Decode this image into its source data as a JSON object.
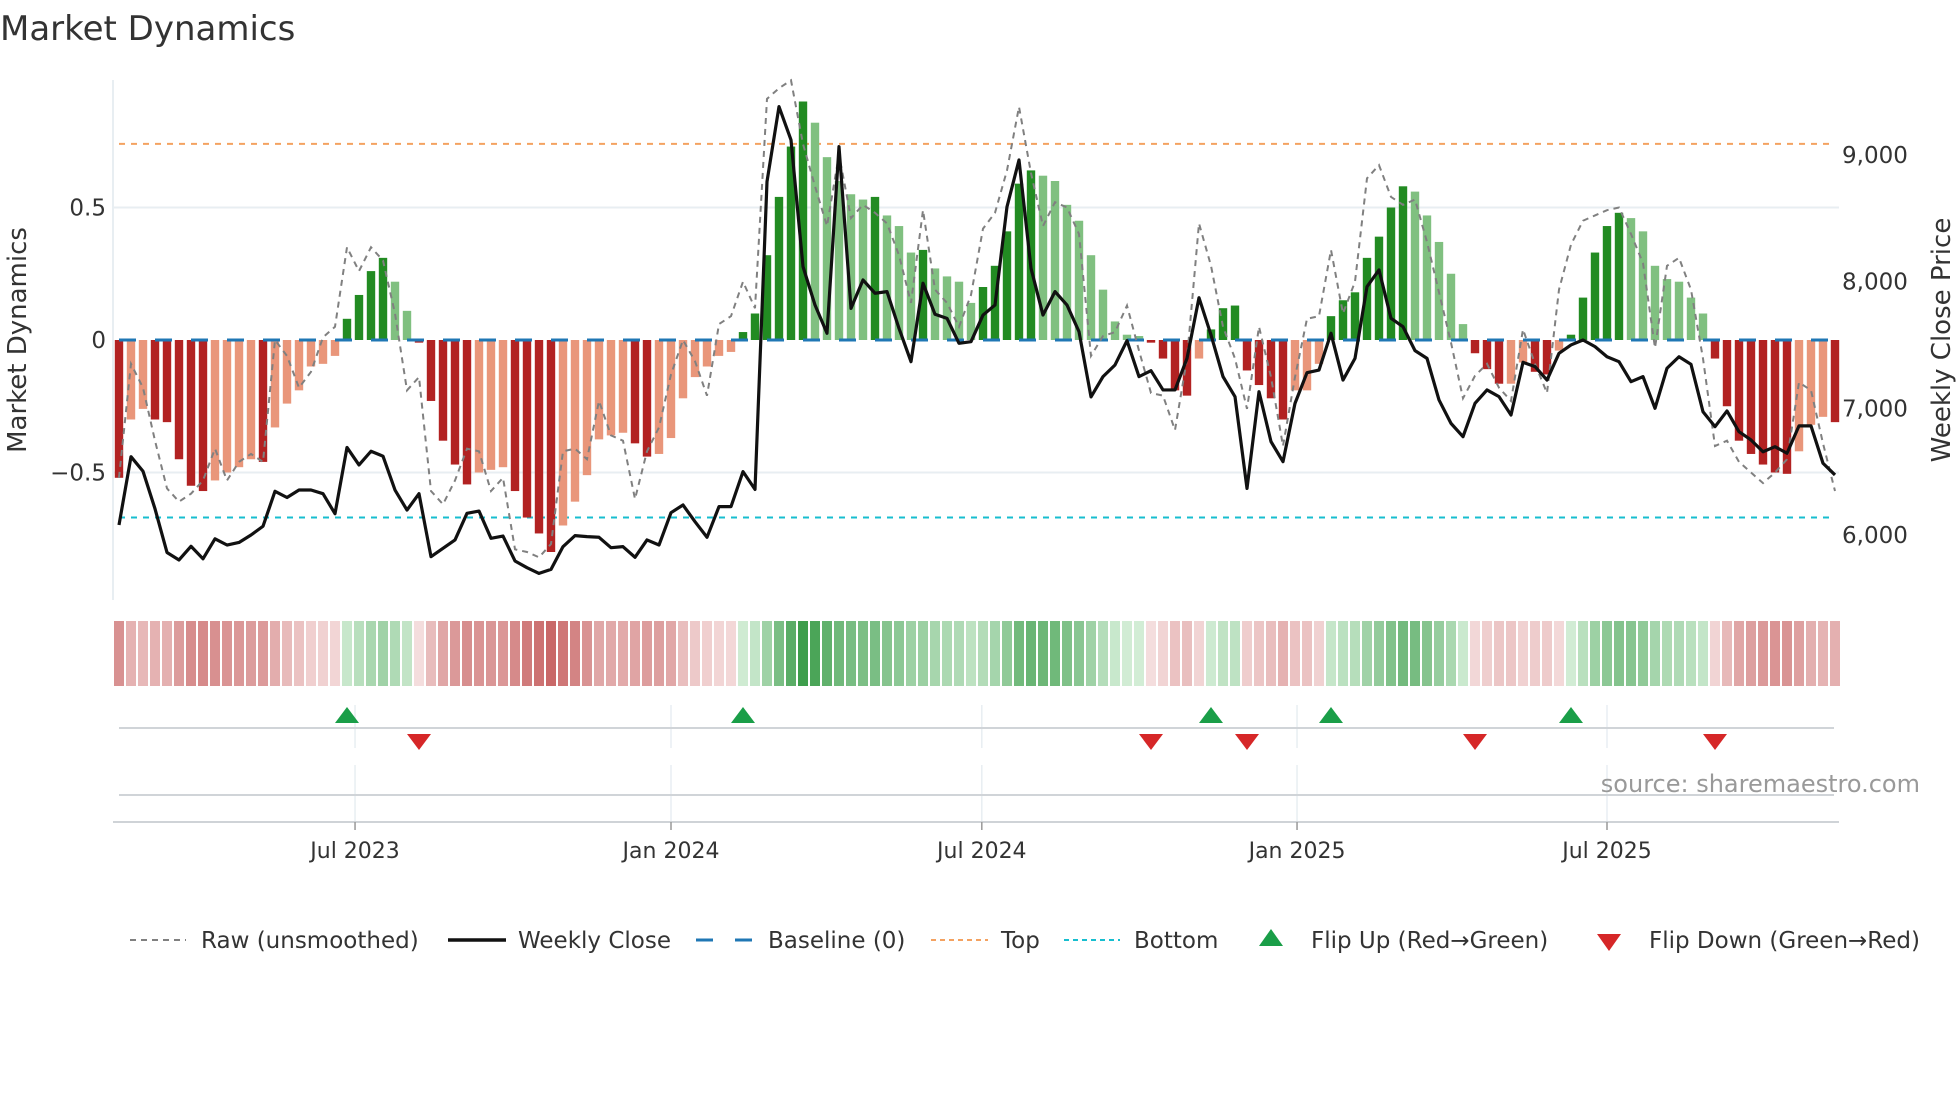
{
  "chart_data": {
    "type": "bar",
    "title": "Market Dynamics",
    "ylabel": "Market Dynamics",
    "y2label": "Weekly Close Price",
    "source": "source: sharemaestro.com",
    "frequency": "weekly",
    "ylim": [
      -0.9,
      1.0
    ],
    "y2lim": [
      5600,
      9700
    ],
    "left_ticks": [
      {
        "value": 0.5,
        "label": "0.5"
      },
      {
        "value": 0,
        "label": "0"
      },
      {
        "value": -0.5,
        "label": "−0.5"
      }
    ],
    "right_ticks": [
      {
        "value": 9000,
        "label": "9,000"
      },
      {
        "value": 8000,
        "label": "8,000"
      },
      {
        "value": 7000,
        "label": "7,000"
      },
      {
        "value": 6000,
        "label": "6,000"
      }
    ],
    "x_ticks": [
      {
        "label": "Jul 2023",
        "week_index": 19.67
      },
      {
        "label": "Jan 2024",
        "week_index": 46.0
      },
      {
        "label": "Jul 2024",
        "week_index": 71.9
      },
      {
        "label": "Jan 2025",
        "week_index": 98.17
      },
      {
        "label": "Jul 2025",
        "week_index": 124.0
      }
    ],
    "top_level": 0.74,
    "bottom_level": -0.67,
    "baseline": 0,
    "colors": {
      "pos_strong": "#228b22",
      "pos_weak": "#80c080",
      "neg_strong": "#b22222",
      "neg_weak": "#e9967a",
      "raw": "#808080",
      "close": "#111111",
      "baseline": "#1f77b4",
      "top": "#f4a261",
      "bottom": "#17becf",
      "flip_up": "#1a9e48",
      "flip_down": "#d62728"
    },
    "series": [
      {
        "name": "Market Dynamics (smoothed)",
        "values": [
          -0.52,
          -0.3,
          -0.26,
          -0.3,
          -0.31,
          -0.45,
          -0.55,
          -0.57,
          -0.53,
          -0.5,
          -0.48,
          -0.45,
          -0.46,
          -0.33,
          -0.24,
          -0.19,
          -0.1,
          -0.09,
          -0.06,
          0.08,
          0.17,
          0.26,
          0.31,
          0.22,
          0.11,
          -0.01,
          -0.23,
          -0.38,
          -0.47,
          -0.545,
          -0.5,
          -0.49,
          -0.48,
          -0.57,
          -0.67,
          -0.73,
          -0.8,
          -0.7,
          -0.61,
          -0.51,
          -0.375,
          -0.36,
          -0.35,
          -0.39,
          -0.44,
          -0.43,
          -0.37,
          -0.22,
          -0.14,
          -0.1,
          -0.06,
          -0.045,
          0.03,
          0.1,
          0.32,
          0.54,
          0.73,
          0.9,
          0.82,
          0.69,
          0.6,
          0.55,
          0.53,
          0.54,
          0.47,
          0.43,
          0.33,
          0.34,
          0.27,
          0.24,
          0.22,
          0.14,
          0.2,
          0.28,
          0.41,
          0.59,
          0.64,
          0.62,
          0.6,
          0.51,
          0.45,
          0.32,
          0.19,
          0.07,
          0.02,
          0.015,
          -0.01,
          -0.07,
          -0.19,
          -0.21,
          -0.07,
          0.04,
          0.12,
          0.13,
          -0.115,
          -0.17,
          -0.22,
          -0.3,
          -0.19,
          -0.19,
          -0.09,
          0.09,
          0.15,
          0.18,
          0.31,
          0.39,
          0.5,
          0.58,
          0.56,
          0.47,
          0.37,
          0.25,
          0.06,
          -0.05,
          -0.11,
          -0.165,
          -0.165,
          -0.085,
          -0.12,
          -0.13,
          -0.04,
          0.02,
          0.16,
          0.33,
          0.43,
          0.48,
          0.46,
          0.41,
          0.28,
          0.23,
          0.22,
          0.16,
          0.1,
          -0.07,
          -0.25,
          -0.38,
          -0.43,
          -0.47,
          -0.5,
          -0.505,
          -0.42,
          -0.32,
          -0.29,
          -0.31
        ]
      },
      {
        "name": "Raw (unsmoothed)",
        "values": [
          -0.52,
          -0.09,
          -0.18,
          -0.38,
          -0.56,
          -0.61,
          -0.58,
          -0.53,
          -0.41,
          -0.53,
          -0.46,
          -0.43,
          -0.46,
          0.0,
          -0.06,
          -0.18,
          -0.12,
          0.01,
          0.05,
          0.35,
          0.26,
          0.35,
          0.3,
          0.1,
          -0.19,
          -0.14,
          -0.57,
          -0.62,
          -0.53,
          -0.41,
          -0.42,
          -0.57,
          -0.52,
          -0.79,
          -0.8,
          -0.82,
          -0.77,
          -0.42,
          -0.41,
          -0.45,
          -0.23,
          -0.36,
          -0.38,
          -0.6,
          -0.42,
          -0.33,
          -0.13,
          0.0,
          -0.08,
          -0.21,
          0.06,
          0.09,
          0.22,
          0.12,
          0.91,
          0.95,
          0.98,
          0.74,
          0.58,
          0.43,
          0.7,
          0.46,
          0.51,
          0.48,
          0.44,
          0.32,
          0.14,
          0.49,
          0.19,
          0.14,
          0.05,
          0.17,
          0.42,
          0.48,
          0.64,
          0.88,
          0.63,
          0.43,
          0.52,
          0.5,
          0.4,
          -0.06,
          0.015,
          0.03,
          0.13,
          -0.04,
          -0.2,
          -0.21,
          -0.34,
          -0.07,
          0.44,
          0.28,
          0.05,
          -0.07,
          -0.26,
          0.05,
          -0.14,
          -0.4,
          -0.14,
          0.08,
          0.09,
          0.34,
          0.1,
          0.22,
          0.61,
          0.66,
          0.54,
          0.51,
          0.53,
          0.37,
          0.18,
          -0.01,
          -0.22,
          -0.135,
          -0.09,
          -0.18,
          -0.23,
          0.04,
          -0.09,
          -0.2,
          0.19,
          0.36,
          0.45,
          0.47,
          0.49,
          0.5,
          0.4,
          0.29,
          -0.03,
          0.28,
          0.31,
          0.19,
          -0.07,
          -0.4,
          -0.38,
          -0.46,
          -0.5,
          -0.54,
          -0.5,
          -0.45,
          -0.16,
          -0.19,
          -0.39,
          -0.57
        ]
      },
      {
        "name": "Weekly Close",
        "axis": "right",
        "values": [
          6079,
          6618,
          6503,
          6207,
          5862,
          5803,
          5911,
          5812,
          5970,
          5921,
          5941,
          6000,
          6069,
          6345,
          6296,
          6355,
          6355,
          6326,
          6168,
          6691,
          6553,
          6661,
          6622,
          6355,
          6197,
          6326,
          5829,
          5895,
          5961,
          6171,
          6189,
          5974,
          5992,
          5795,
          5742,
          5697,
          5729,
          5908,
          5995,
          5987,
          5982,
          5900,
          5908,
          5824,
          5961,
          5921,
          6176,
          6237,
          6105,
          5982,
          6224,
          6224,
          6500,
          6360,
          8789,
          9381,
          9118,
          8118,
          7815,
          7592,
          9065,
          7789,
          8013,
          7908,
          7921,
          7631,
          7368,
          7987,
          7742,
          7710,
          7513,
          7526,
          7736,
          7815,
          8591,
          8960,
          8105,
          7736,
          7921,
          7815,
          7605,
          7090,
          7250,
          7342,
          7534,
          7250,
          7297,
          7145,
          7145,
          7394,
          7873,
          7579,
          7250,
          7092,
          6368,
          7131,
          6737,
          6579,
          7039,
          7281,
          7302,
          7592,
          7223,
          7394,
          7960,
          8092,
          7710,
          7644,
          7455,
          7394,
          7066,
          6881,
          6776,
          7039,
          7145,
          7092,
          6947,
          7363,
          7329,
          7223,
          7434,
          7500,
          7539,
          7487,
          7407,
          7368,
          7210,
          7250,
          7000,
          7316,
          7407,
          7347,
          6973,
          6855,
          6979,
          6815,
          6750,
          6657,
          6697,
          6645,
          6861,
          6861,
          6566,
          6474
        ]
      }
    ],
    "flip_up_weeks": [
      20,
      53,
      92,
      102,
      122
    ],
    "flip_down_weeks": [
      26,
      87,
      95,
      114,
      134
    ],
    "legend": {
      "placement": "bottom",
      "raw": "Raw (unsmoothed)",
      "close": "Weekly Close",
      "baseline": "Baseline (0)",
      "top": "Top",
      "bottom": "Bottom",
      "flip_up": "Flip Up (Red→Green)",
      "flip_down": "Flip Down (Green→Red)"
    }
  }
}
